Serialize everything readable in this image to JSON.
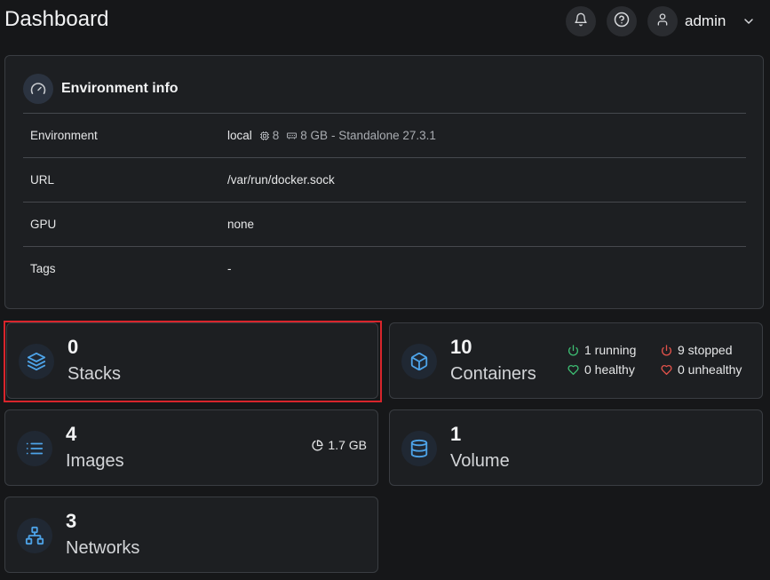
{
  "header": {
    "title": "Dashboard",
    "user_name": "admin"
  },
  "environment_info": {
    "title": "Environment info",
    "rows": [
      {
        "key": "Environment",
        "value": "local",
        "cpu": "8",
        "memory": "8 GB",
        "suffix": "- Standalone 27.3.1"
      },
      {
        "key": "URL",
        "value": "/var/run/docker.sock"
      },
      {
        "key": "GPU",
        "value": "none"
      },
      {
        "key": "Tags",
        "value": "-"
      }
    ]
  },
  "stats": {
    "stacks": {
      "count": "0",
      "label": "Stacks"
    },
    "containers": {
      "count": "10",
      "label": "Containers",
      "running": "1 running",
      "stopped": "9 stopped",
      "healthy": "0 healthy",
      "unhealthy": "0 unhealthy"
    },
    "images": {
      "count": "4",
      "label": "Images",
      "size": "1.7 GB"
    },
    "volumes": {
      "count": "1",
      "label": "Volume"
    },
    "networks": {
      "count": "3",
      "label": "Networks"
    }
  },
  "colors": {
    "background": "#161719",
    "card": "#1d1f22",
    "accent_icon": "#4da3e8",
    "running": "#3dbe73",
    "stopped": "#e5534b",
    "highlight": "#d9252c"
  },
  "icons": {
    "bell": "bell-icon",
    "help": "help-circle-icon",
    "user": "user-icon",
    "chevron": "chevron-down-icon",
    "gauge": "gauge-icon",
    "stacks": "layers-icon",
    "containers": "box-icon",
    "images": "list-icon",
    "volumes": "database-icon",
    "networks": "network-icon"
  }
}
